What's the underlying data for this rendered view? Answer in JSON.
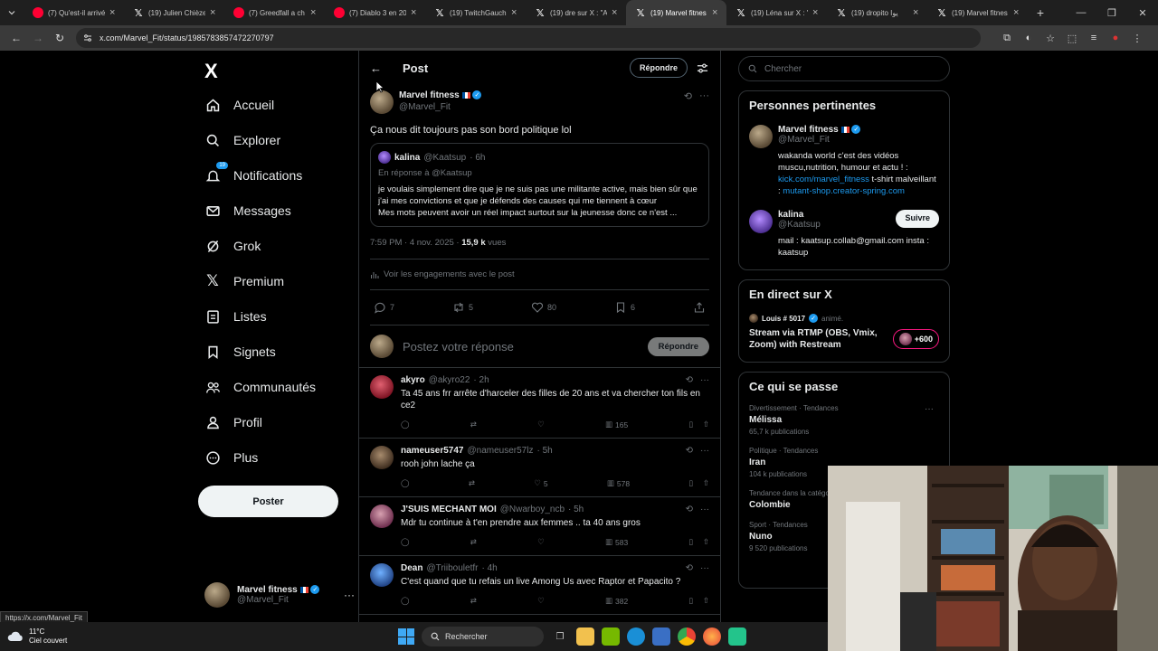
{
  "browser": {
    "tabs": [
      {
        "label": "(7) Qu'est-il arrivé",
        "icon": "youtube-icon",
        "active": false
      },
      {
        "label": "(19) Julien Chièze",
        "icon": "x-icon",
        "active": false
      },
      {
        "label": "(7) Greedfall a ch",
        "icon": "youtube-icon",
        "active": false
      },
      {
        "label": "(7) Diablo 3 en 20",
        "icon": "youtube-icon",
        "active": false
      },
      {
        "label": "(19) TwitchGauch",
        "icon": "x-icon",
        "active": false
      },
      {
        "label": "(19) dre sur X : \"A",
        "icon": "x-icon",
        "active": false
      },
      {
        "label": "(19) Marvel fitnes",
        "icon": "x-icon",
        "active": true
      },
      {
        "label": "(19) Léna sur X : \"",
        "icon": "x-icon",
        "active": false
      },
      {
        "label": "(19) dropito يوا",
        "icon": "x-icon",
        "active": false
      },
      {
        "label": "(19) Marvel fitnes",
        "icon": "x-icon",
        "active": false
      }
    ],
    "url": "x.com/Marvel_Fit/status/1985783857472270797",
    "status_url": "https://x.com/Marvel_Fit"
  },
  "nav": {
    "logo": "X",
    "items": [
      {
        "label": "Accueil",
        "icon": "home-icon"
      },
      {
        "label": "Explorer",
        "icon": "search-icon"
      },
      {
        "label": "Notifications",
        "icon": "bell-icon",
        "badge": "19"
      },
      {
        "label": "Messages",
        "icon": "mail-icon"
      },
      {
        "label": "Grok",
        "icon": "grok-icon"
      },
      {
        "label": "Premium",
        "icon": "x-icon"
      },
      {
        "label": "Listes",
        "icon": "list-icon"
      },
      {
        "label": "Signets",
        "icon": "bookmark-icon"
      },
      {
        "label": "Communautés",
        "icon": "people-icon"
      },
      {
        "label": "Profil",
        "icon": "person-icon"
      },
      {
        "label": "Plus",
        "icon": "more-circle-icon"
      }
    ],
    "post_button": "Poster",
    "account": {
      "name": "Marvel fitness",
      "handle": "@Marvel_Fit"
    }
  },
  "main": {
    "header_title": "Post",
    "header_reply": "Répondre",
    "post": {
      "author": "Marvel fitness",
      "handle": "@Marvel_Fit",
      "text": "Ça nous dit toujours pas son bord politique lol",
      "quote": {
        "author": "kalina",
        "handle": "@Kaatsup",
        "time": "· 6h",
        "reply_to": "En réponse à @Kaatsup",
        "text1": "je voulais simplement dire que je ne suis pas une militante active, mais bien sûr que j'ai mes convictions et que je défends des causes qui me tiennent à cœur",
        "text2": "Mes mots peuvent avoir un réel impact surtout sur la jeunesse donc ce n'est ..."
      },
      "time": "7:59 PM · 4 nov. 2025 · ",
      "views": "15,9 k",
      "views_label": " vues",
      "engagements": "Voir les engagements avec le post",
      "counts": {
        "replies": "7",
        "reposts": "5",
        "likes": "80",
        "bookmarks": "6"
      }
    },
    "composer": {
      "placeholder": "Postez votre réponse",
      "button": "Répondre"
    },
    "replies": [
      {
        "name": "akyro",
        "handle": "@akyro22",
        "time": "· 2h",
        "text": "Ta 45 ans frr arrête d'harceler des filles de 20 ans et va chercher ton fils en ce2",
        "avatar": "red",
        "replies": "",
        "reposts": "",
        "likes": "",
        "views": "165"
      },
      {
        "name": "nameuser5747",
        "handle": "@nameuser57lz",
        "time": "· 5h",
        "text": "rooh john lache ça",
        "avatar": "brown",
        "replies": "",
        "reposts": "",
        "likes": "5",
        "views": "578"
      },
      {
        "name": "J'SUIS MECHANT MOI",
        "handle": "@Nwarboy_ncb",
        "time": "· 5h",
        "text": "Mdr tu continue à t'en prendre aux femmes .. ta 40 ans gros",
        "avatar": "pink",
        "replies": "",
        "reposts": "",
        "likes": "",
        "views": "583"
      },
      {
        "name": "Dean",
        "handle": "@Triibouletfr",
        "time": "· 4h",
        "text": "C'est quand que tu refais un live Among Us avec Raptor et Papacito ?",
        "avatar": "blue",
        "replies": "",
        "reposts": "",
        "likes": "",
        "views": "382"
      }
    ]
  },
  "right": {
    "search_placeholder": "Chercher",
    "relevant_title": "Personnes pertinentes",
    "people": [
      {
        "name": "Marvel fitness",
        "handle": "@Marvel_Fit",
        "bio_pre": "wakanda world c'est des vidéos muscu,nutrition, humour et actu ! : ",
        "bio_link1": "kick.com/marvel_fitness",
        "bio_mid": " t-shirt malveillant : ",
        "bio_link2": "mutant-shop.creator-spring.com"
      },
      {
        "name": "kalina",
        "handle": "@Kaatsup",
        "follow": "Suivre",
        "bio": "mail : kaatsup.collab@gmail.com insta : kaatsup"
      }
    ],
    "live_title": "En direct sur X",
    "live": {
      "host": "Louis # 5017",
      "tag": "animé.",
      "text": "Stream via RTMP (OBS, Vmix, Zoom) with Restream",
      "count": "+600"
    },
    "trends_title": "Ce qui se passe",
    "trends": [
      {
        "category": "Divertissement · Tendances",
        "name": "Mélissa",
        "count": "65,7 k publications"
      },
      {
        "category": "Politique · Tendances",
        "name": "Iran",
        "count": "104 k publications"
      },
      {
        "category": "Tendance dans la catégorie",
        "name": "Colombie",
        "count": ""
      },
      {
        "category": "Sport · Tendances",
        "name": "Nuno",
        "count": "9 520 publications"
      }
    ]
  },
  "taskbar": {
    "temperature": "11°C",
    "weather": "Ciel couvert",
    "search": "Rechercher"
  },
  "colors": {
    "accent": "#1d9bf0",
    "background": "#000000",
    "border": "#2f3336",
    "muted": "#71767b"
  }
}
